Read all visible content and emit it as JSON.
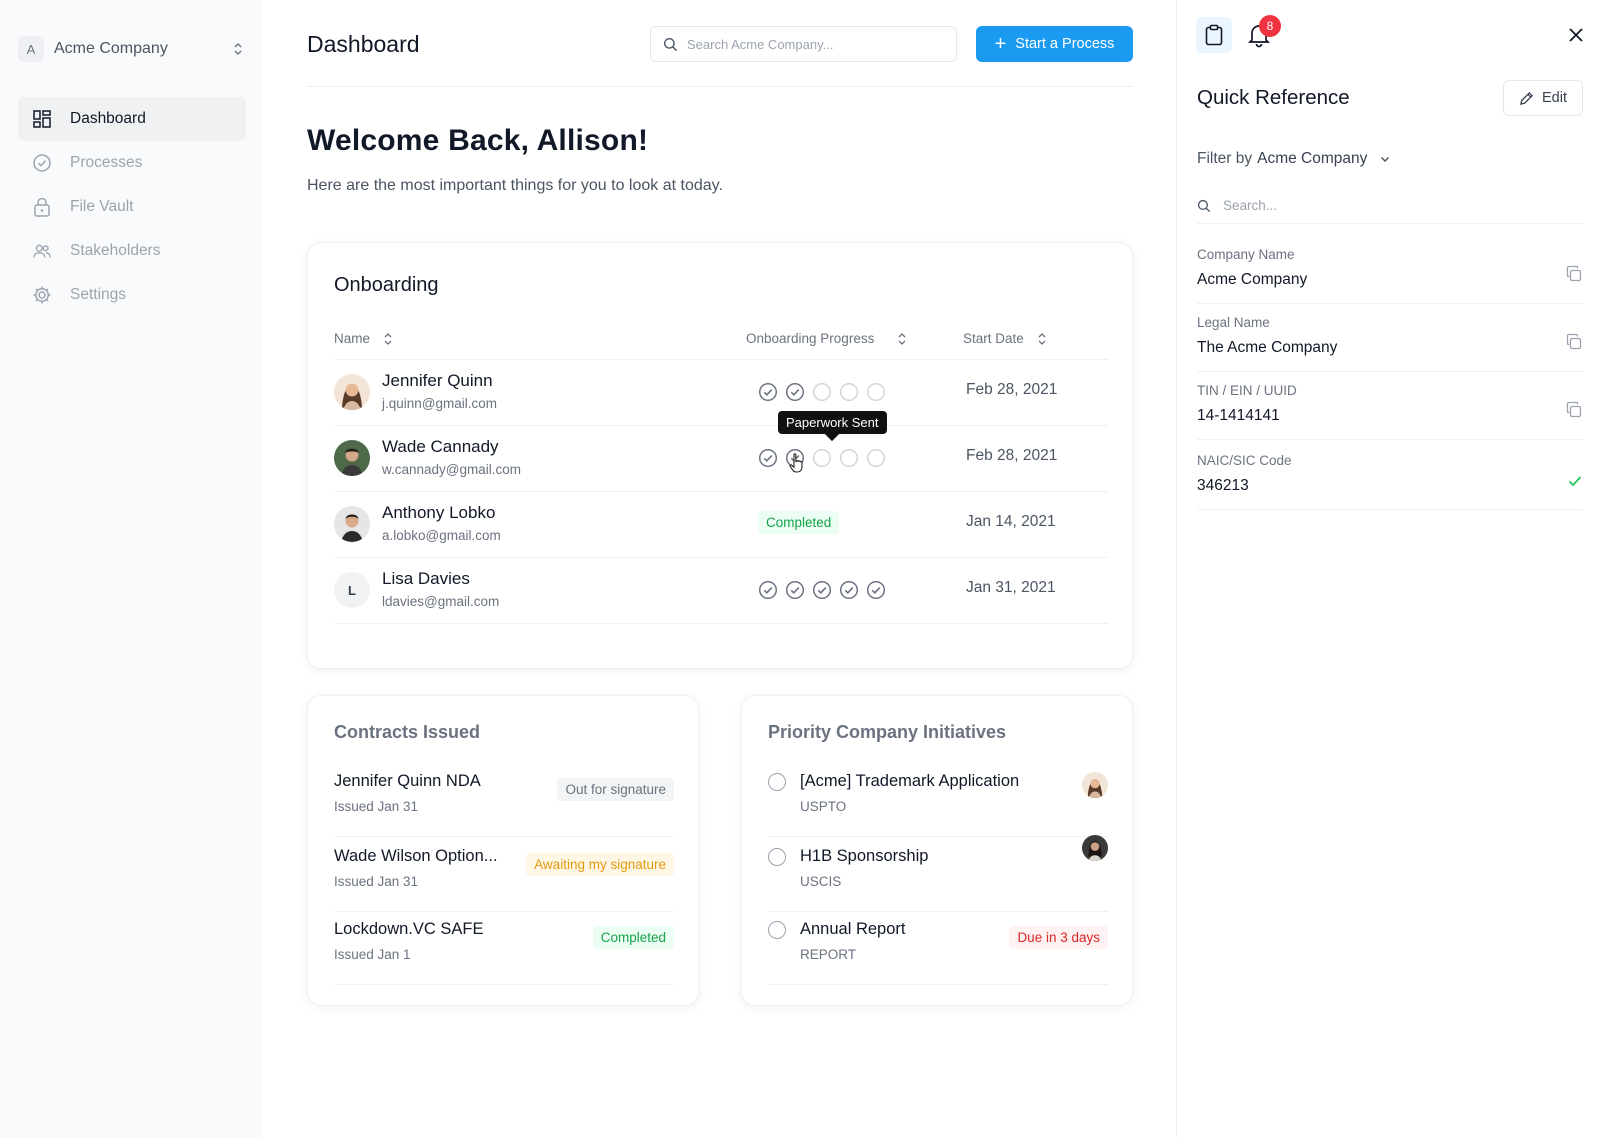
{
  "sidebar": {
    "company_initial": "A",
    "company_name": "Acme Company",
    "items": [
      {
        "label": "Dashboard",
        "icon": "dashboard-grid-icon",
        "active": true
      },
      {
        "label": "Processes",
        "icon": "check-circle-icon",
        "active": false
      },
      {
        "label": "File Vault",
        "icon": "lock-icon",
        "active": false
      },
      {
        "label": "Stakeholders",
        "icon": "users-icon",
        "active": false
      },
      {
        "label": "Settings",
        "icon": "gear-icon",
        "active": false
      }
    ]
  },
  "header": {
    "title": "Dashboard",
    "search_placeholder": "Search Acme Company...",
    "primary_button": "Start a Process"
  },
  "welcome": {
    "title": "Welcome Back, Allison!",
    "subtitle": "Here are the most important things for you to look at today."
  },
  "onboarding": {
    "title": "Onboarding",
    "columns": [
      "Name",
      "Onboarding Progress",
      "Start Date"
    ],
    "tooltip": "Paperwork Sent",
    "rows": [
      {
        "name": "Jennifer Quinn",
        "email": "j.quinn@gmail.com",
        "steps_done": 2,
        "steps_total": 5,
        "status": "",
        "date": "Feb 28, 2021"
      },
      {
        "name": "Wade Cannady",
        "email": "w.cannady@gmail.com",
        "steps_done": 2,
        "steps_total": 5,
        "status": "",
        "date": "Feb 28, 2021"
      },
      {
        "name": "Anthony Lobko",
        "email": "a.lobko@gmail.com",
        "steps_done": 5,
        "steps_total": 5,
        "status": "Completed",
        "date": "Jan 14, 2021"
      },
      {
        "name": "Lisa Davies",
        "email": "ldavies@gmail.com",
        "initial": "L",
        "steps_done": 5,
        "steps_total": 5,
        "status": "",
        "date": "Jan 31, 2021"
      }
    ]
  },
  "contracts": {
    "title": "Contracts Issued",
    "items": [
      {
        "title": "Jennifer Quinn NDA",
        "sub": "Issued Jan 31",
        "status": "Out for signature",
        "color": "#6b7280"
      },
      {
        "title": "Wade Wilson Option...",
        "sub": "Issued Jan 31",
        "status": "Awaiting my signature",
        "color": "#e59b10"
      },
      {
        "title": "Lockdown.VC SAFE",
        "sub": "Issued Jan 1",
        "status": "Completed",
        "color": "#16a34a"
      }
    ]
  },
  "initiatives": {
    "title": "Priority Company Initiatives",
    "items": [
      {
        "title": "[Acme] Trademark Application",
        "sub": "USPTO",
        "status": ""
      },
      {
        "title": "H1B Sponsorship",
        "sub": "USCIS",
        "status": ""
      },
      {
        "title": "Annual Report",
        "sub": "REPORT",
        "status": "Due in 3 days"
      }
    ]
  },
  "panel": {
    "notification_count": "8",
    "title": "Quick Reference",
    "edit_label": "Edit",
    "filter_prefix": "Filter by",
    "filter_value": "Acme Company",
    "search_placeholder": "Search...",
    "fields": [
      {
        "label": "Company Name",
        "value": "Acme Company",
        "action": "copy"
      },
      {
        "label": "Legal Name",
        "value": "The Acme Company",
        "action": "copy"
      },
      {
        "label": "TIN / EIN / UUID",
        "value": "14-1414141",
        "action": "copy"
      },
      {
        "label": "NAIC/SIC Code",
        "value": "346213",
        "action": "verified"
      }
    ]
  },
  "colors": {
    "accent": "#1a9af0",
    "success": "#16a34a",
    "warning": "#e59b10",
    "danger": "#dc2626",
    "badge": "#ef3340"
  }
}
